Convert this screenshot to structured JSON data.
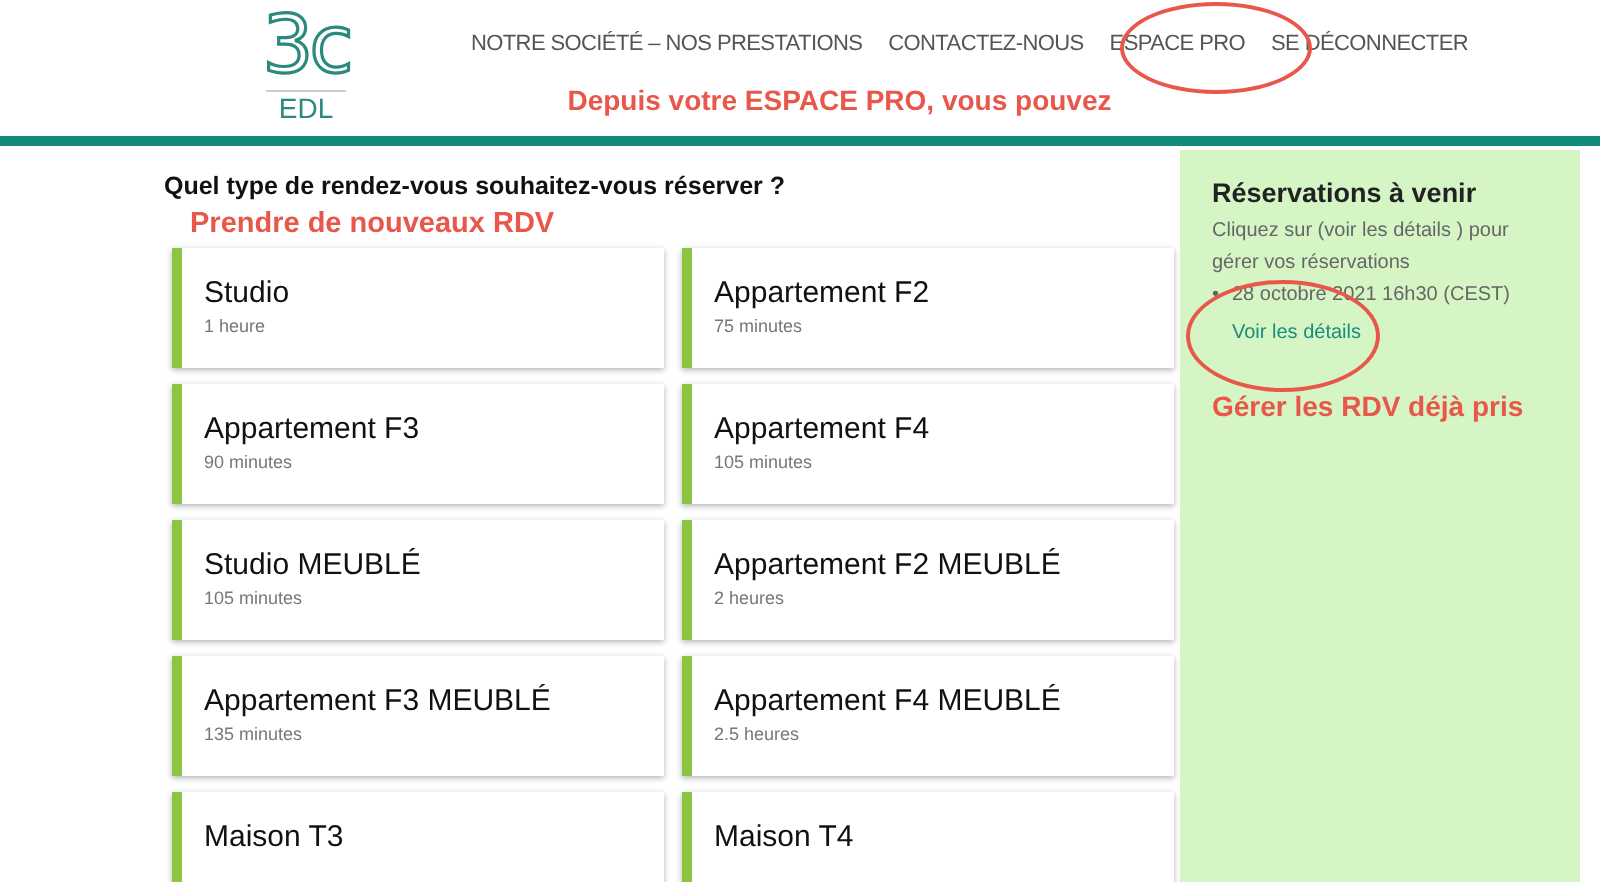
{
  "logo": {
    "mark": "3c",
    "subtitle": "EDL"
  },
  "nav": [
    {
      "label": "NOTRE SOCIÉTÉ – NOS PRESTATIONS"
    },
    {
      "label": "CONTACTEZ-NOUS"
    },
    {
      "label": "ESPACE PRO"
    },
    {
      "label": "SE DÉCONNECTER"
    }
  ],
  "header_note": "Depuis votre ESPACE PRO, vous pouvez",
  "question": "Quel type de rendez-vous souhaitez-vous réserver ?",
  "booking_note": "Prendre de nouveaux RDV",
  "services": [
    {
      "name": "Studio",
      "duration": "1 heure"
    },
    {
      "name": "Appartement F2",
      "duration": "75 minutes"
    },
    {
      "name": "Appartement F3",
      "duration": "90 minutes"
    },
    {
      "name": "Appartement F4",
      "duration": "105 minutes"
    },
    {
      "name": "Studio MEUBLÉ",
      "duration": "105 minutes"
    },
    {
      "name": "Appartement F2 MEUBLÉ",
      "duration": "2 heures"
    },
    {
      "name": "Appartement F3 MEUBLÉ",
      "duration": "135 minutes"
    },
    {
      "name": "Appartement F4 MEUBLÉ",
      "duration": "2.5 heures"
    },
    {
      "name": "Maison T3"
    },
    {
      "name": "Maison T4"
    }
  ],
  "reservations": {
    "title": "Réservations à venir",
    "hint": "Cliquez sur (voir les détails ) pour gérer vos réservations",
    "items": [
      {
        "bullet": "•",
        "date": "28 octobre 2021 16h30 (CEST)",
        "link": "Voir les détails"
      }
    ],
    "note": "Gérer les RDV déjà pris"
  }
}
